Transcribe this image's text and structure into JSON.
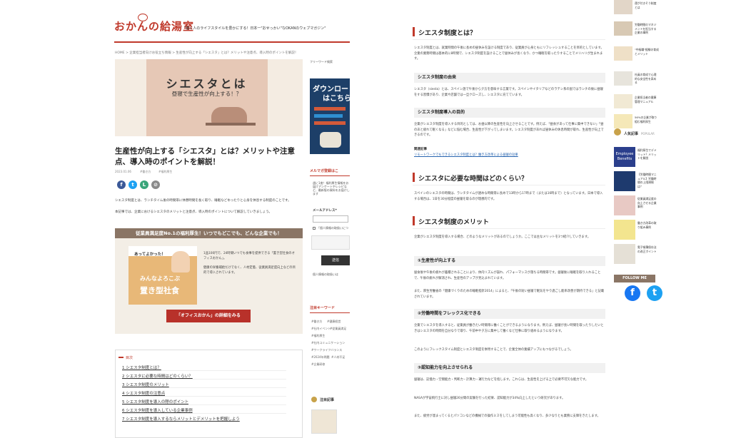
{
  "site": {
    "logo": "おかんの給湯室",
    "tagline": "\"働く人のライフスタイルを豊かにする！日本一\"おせっかい\"なOKANのウェブマガジン\"",
    "breadcrumb": "HOME > 企業担当者向けお役立ち情報 > 生産性が向上する「シエスタ」とは？メリットや注意点、導入時のポイントを解説！"
  },
  "hero": {
    "title": "シエスタとは",
    "subtitle": "昼寝で生産性が向上する！？"
  },
  "article": {
    "title": "生産性が向上する「シエスタ」とは？メリットや注意点、導入時のポイントを解説！",
    "date": "2023.01.06",
    "tags": [
      "#働き方",
      "#福利厚生"
    ],
    "intro1": "シエスタ制度とは、ランチタイム後の時間帯に休憩時間を長く取り、睡眠などゆったりと心身を休息する制度のことです。",
    "intro2": "本記事では、企業におけるシエスタのメリットと注意点、導入時のポイントについて解説していきましょう。"
  },
  "social": [
    {
      "name": "facebook",
      "glyph": "f",
      "color": "#3b5998"
    },
    {
      "name": "twitter",
      "glyph": "t",
      "color": "#1da1f2"
    },
    {
      "name": "line",
      "glyph": "L",
      "color": "#00b900"
    },
    {
      "name": "link",
      "glyph": "⊘",
      "color": "#8a8a8a"
    }
  ],
  "promo": {
    "header": "従業員満足度No.1の福利厚生！いつでもどこでも、どんな企業でも！",
    "bubble": "あってよかった！",
    "img_line1": "みんなよろこぶ",
    "img_line2": "置き型社食",
    "text1": "1品100円で、24時間いつでも食事を提供できる「置き型社食のオフィスおかん」。",
    "text2": "健康の栄養補給だけでなく、人材定着、従業員満足度向上などの目的で導入されています。",
    "button": "「オフィスおかん」の詳細をみる"
  },
  "toc": {
    "heading": "目次",
    "items": [
      "1 シエスタ制度とは？",
      "2 シエスタに必要な時間はどのくらい？",
      "3 シエスタ制度のメリット",
      "4 シエスタ制度の注意点",
      "5 シエスタ制度を導入の際のポイント",
      "6 シエスタ制度を導入している企業事例",
      "7 シエスタ制度を導入するならメリットとデメリットを把握しよう"
    ]
  },
  "left_sidebar": {
    "ad_label": "フリーワード検索",
    "ad_title1": "ダウンロー",
    "ad_title2": "はこちら",
    "mag_head": "メルマガ登録はこ",
    "mag_text": "週に1度！福利厚生情報をお届けアンケートやレシピなど、最新版の資料をお届けします",
    "mail_label": "メールアドレス*",
    "checkbox": "「個人情報の取扱いについて」に同意する",
    "submit": "送信",
    "notice": "個人情報の取扱いは",
    "keyword_head": "注目キーワード",
    "keywords": [
      "#働き方",
      "#健康経営",
      "#社内イベント",
      "#従業員満足",
      "#福利厚生",
      "#社内コミュニケーション",
      "#ワークライフバランス",
      "#2024年問題",
      "#人材不足",
      "#企業研修"
    ],
    "pop_head": "注目記事"
  },
  "right": {
    "h_siesta": "シエスタ制度とは？",
    "p_siesta": "シエスタ制度とは、就業時間の午後に長めの昼休みを設ける制度であり、従業員が心身ともにリフレッシュすることを目的としています。企業の業務時間は基本的に8時間で、シエスタ制度を設けることで昼休みが長くなり、かつ睡眠を取ったりすることでメリハリが生まれます。",
    "h_origin": "シエスタ制度の由来",
    "p_origin": "シエスタ（siesta）とは、スペイン語で午後から夕方を意味する言葉です。スペインやイタリアなどのラテン系の国ではランチの後に昼寝をする習慣があり、企業や店舗では一旦クローズし、シエスタに充てています。",
    "h_purpose": "シエスタ制度導入の目的",
    "p_purpose": "企業がシエスタ制度を導入する目的としては、お昼以降の生産性を向上させることです。例えば、「昼食があって仕事に集中できない」「昼のあと疲れて眠くなる」などに悩む場合、生産性が下がってしまいます。シエスタ制度があれば昼休みの休息時間が取れ、生産性が向上できるのです。",
    "rel_label": "関連記事",
    "rel_link": "リモートワークでもできるシエスタ制度とは？働き方改革による昼寝の効果",
    "h_time": "シエスタに必要な時間はどのくらい？",
    "p_time": "スペインのシエスタの時間は、ランチタイムが遅めな時間帯に長めで13時から17時まで（または16時まで）となっています。日本で導入する場合は、1日を30分程度の昼寝を取るのが理想的です。",
    "h_merit": "シエスタ制度のメリット",
    "p_merit": "企業がシエスタ制度を導入する場合、どのようなメリットがあるのでしょうか。ここでは主なメリットを3つ紹介していきます。",
    "h_m1": "①生産性が向上する",
    "p_m1": "昼食後や午後の疲れが蓄積されることにより、体内リズムが崩れ、パフォーマンスが落ちる時間帯です。昼寝後に睡眠を取り入れることで、午後の疲れが解消され、生産性のアップが見込まれています。",
    "p_m1b": "また、厚生労働省の「健康づくりのための睡眠指針2014」によると、「午後の短い昼寝で眠気をやり過ごし能率改善が期待できる」と記載されています。",
    "h_m2": "②労働時間をフレックス化できる",
    "p_m2": "企業でシエスタを導入すると、従業員が働きたい時間帯に働くことができるようになります。例えば、昼寝が長い時間を取ったりしたいときはシエスタの時間を自分なりで取り、午前中や夕方に集中して働くなど仕事に取り組めるようになります。",
    "p_m2b": "このようにフレックスタイム制度とシエスタ制度を併用することで、企業全体の業績アップにもつながるでしょう。",
    "h_m3": "③認知能力を向上させられる",
    "p_m3": "昼寝は、記憶力・空間能力・判断力・計算力・運行力などを指します。これらは、生産性を上げる上で必要不可欠な能力です。",
    "p_m3b": "NASAが宇宙飛行士に対し昼寝26分間の実験を行った結果、認知能力が34%向上したという研究があります。",
    "p_m3c": "また、疲労が溜まってくるとパソコンなどの機械での操作ミスをしてしまう可能性も高くなり、多少なりとも業務に支障をきたします。"
  },
  "far": {
    "top_items": [
      "運が付きそう制度とは",
      "労働時間のマネジメントを担当する企業の事例",
      "\"中級職\"経験の育成とメリット",
      "社員の育成で心理的な安全性を高める"
    ],
    "items_mid": [
      "企業担当者の健康管理マニュアル",
      "56%の企業が取り組む福利厚生",
      "社内表彰制度の事例"
    ],
    "pop_head": "人気記事",
    "pop_sub": "POPULAR",
    "pop_items": [
      "福利厚生でデメリット？メリットを解説",
      "【労働時間マニュアル】労働時間の上限規制は？",
      "従業員満足度の向上させる企業事例",
      "働き方改革の取り組み事例",
      "電子帳簿保存法の改正ポイント"
    ],
    "follow": "FOLLOW ME",
    "employee_img": "Employee Benefits"
  }
}
